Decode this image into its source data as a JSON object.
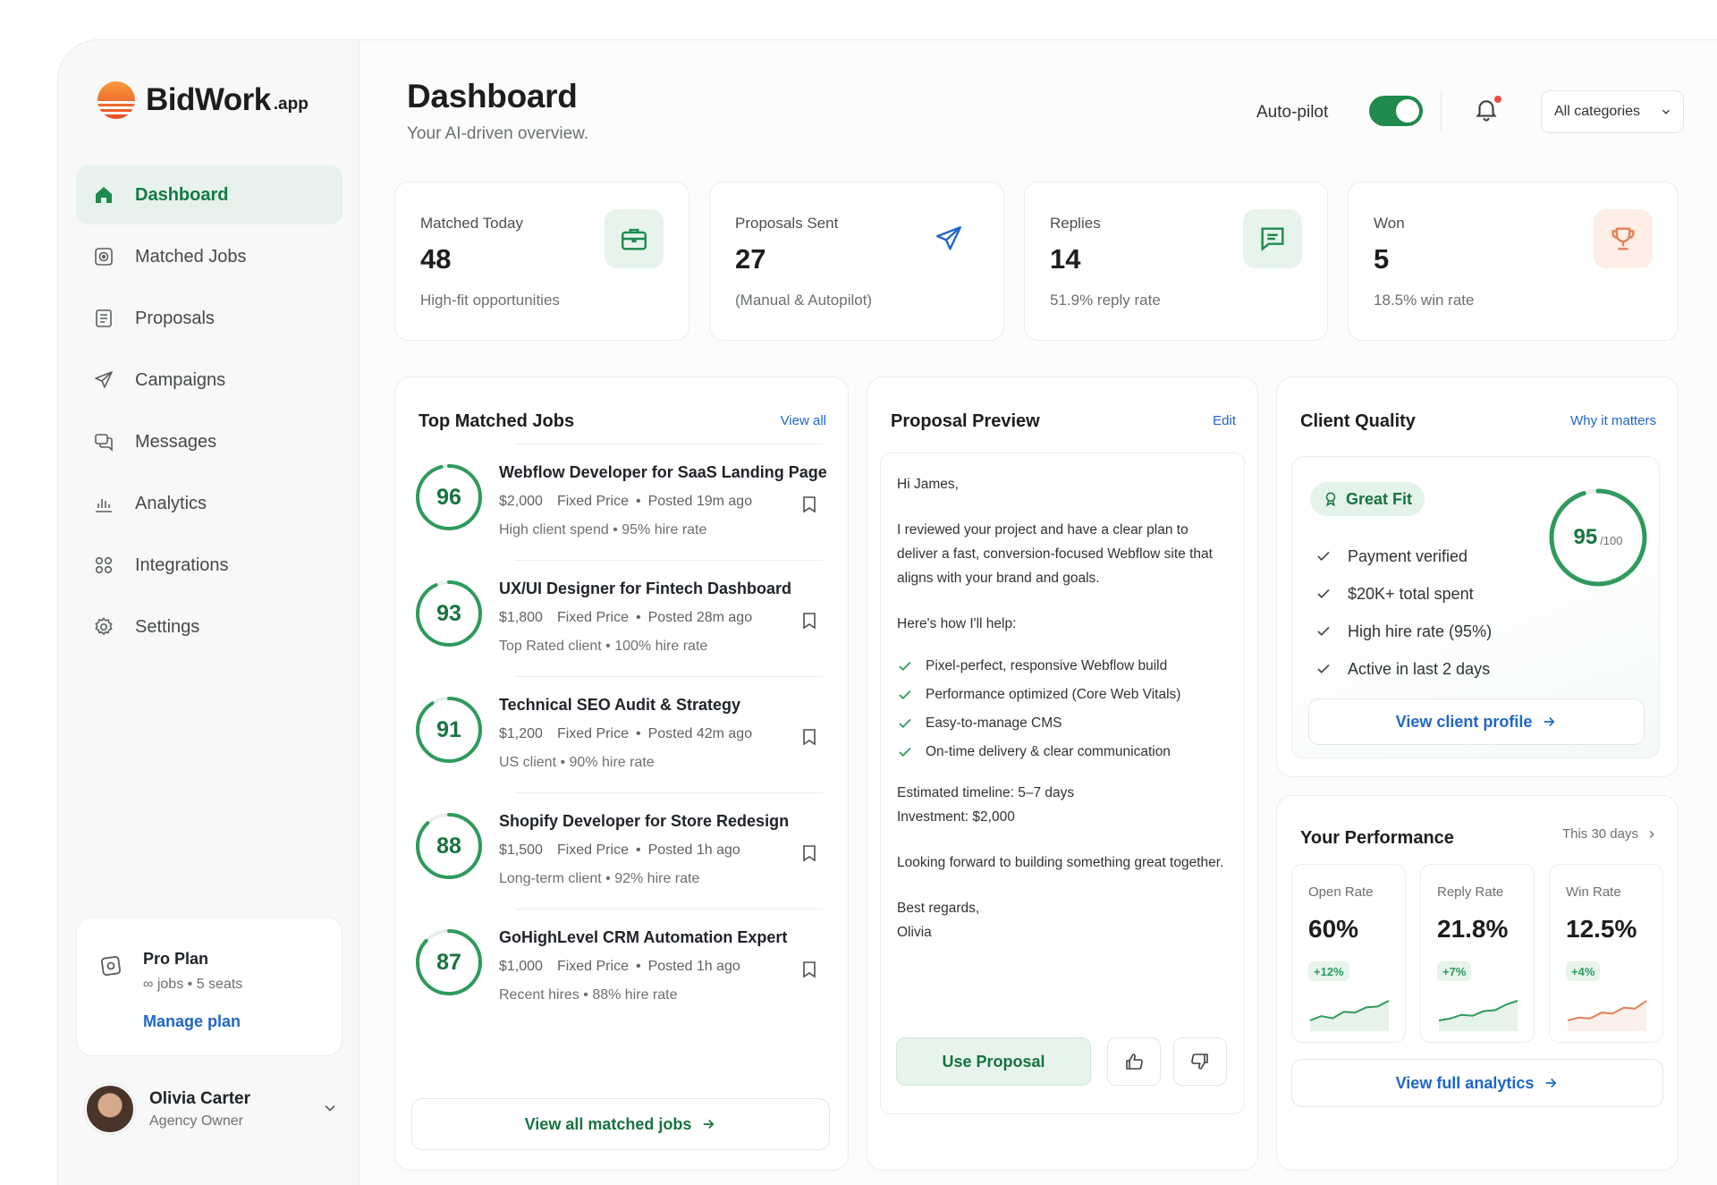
{
  "brand": {
    "name": "BidWork",
    "suffix": ".app"
  },
  "sidebar": {
    "items": [
      {
        "label": "Dashboard",
        "icon": "home-icon"
      },
      {
        "label": "Matched Jobs",
        "icon": "target-icon"
      },
      {
        "label": "Proposals",
        "icon": "document-icon"
      },
      {
        "label": "Campaigns",
        "icon": "send-icon"
      },
      {
        "label": "Messages",
        "icon": "chat-icon"
      },
      {
        "label": "Analytics",
        "icon": "bar-chart-icon"
      },
      {
        "label": "Integrations",
        "icon": "grid-icon"
      },
      {
        "label": "Settings",
        "icon": "gear-icon"
      }
    ],
    "plan": {
      "title": "Pro Plan",
      "detail": "∞ jobs • 5 seats",
      "link": "Manage plan"
    },
    "user": {
      "name": "Olivia Carter",
      "role": "Agency Owner"
    }
  },
  "header": {
    "title": "Dashboard",
    "subtitle": "Your AI-driven overview.",
    "autopilot_label": "Auto-pilot",
    "autopilot_on": true,
    "category": "All categories"
  },
  "stats": [
    {
      "label": "Matched Today",
      "value": "48",
      "sub": "High-fit opportunities",
      "icon": "briefcase-icon"
    },
    {
      "label": "Proposals Sent",
      "value": "27",
      "sub": "(Manual & Autopilot)",
      "icon": "paper-plane-icon"
    },
    {
      "label": "Replies",
      "value": "14",
      "sub": "51.9% reply rate",
      "icon": "message-icon"
    },
    {
      "label": "Won",
      "value": "5",
      "sub": "18.5% win rate",
      "icon": "trophy-icon"
    }
  ],
  "jobs": {
    "title": "Top Matched Jobs",
    "view_all": "View all",
    "items": [
      {
        "score": "96",
        "score_value": 96,
        "title": "Webflow Developer for SaaS Landing Page",
        "price": "$2,000",
        "type": "Fixed Price",
        "posted": "Posted 19m ago",
        "note": "High client spend • 95% hire rate"
      },
      {
        "score": "93",
        "score_value": 93,
        "title": "UX/UI Designer for Fintech Dashboard",
        "price": "$1,800",
        "type": "Fixed Price",
        "posted": "Posted 28m ago",
        "note": "Top Rated client • 100% hire rate"
      },
      {
        "score": "91",
        "score_value": 91,
        "title": "Technical SEO Audit & Strategy",
        "price": "$1,200",
        "type": "Fixed Price",
        "posted": "Posted 42m ago",
        "note": "US client • 90% hire rate"
      },
      {
        "score": "88",
        "score_value": 88,
        "title": "Shopify Developer for Store Redesign",
        "price": "$1,500",
        "type": "Fixed Price",
        "posted": "Posted 1h ago",
        "note": "Long-term client • 92% hire rate"
      },
      {
        "score": "87",
        "score_value": 87,
        "title": "GoHighLevel CRM Automation Expert",
        "price": "$1,000",
        "type": "Fixed Price",
        "posted": "Posted 1h ago",
        "note": "Recent hires • 88% hire rate"
      }
    ],
    "view_all_button": "View all matched jobs"
  },
  "proposal": {
    "title": "Proposal Preview",
    "edit": "Edit",
    "greeting": "Hi James,",
    "intro": "I reviewed your project and have a clear plan to deliver a fast, conversion-focused Webflow site that aligns with your brand and goals.",
    "help_heading": "Here's how I'll help:",
    "points": [
      "Pixel-perfect, responsive Webflow build",
      "Performance optimized (Core Web Vitals)",
      "Easy-to-manage CMS",
      "On-time delivery & clear communication"
    ],
    "timeline": "Estimated timeline: 5–7 days",
    "investment": "Investment: $2,000",
    "closing": "Looking forward to building something great together.",
    "signoff": "Best regards,",
    "signature": "Olivia",
    "use_button": "Use Proposal"
  },
  "client_quality": {
    "title": "Client Quality",
    "link": "Why it matters",
    "badge": "Great Fit",
    "checks": [
      "Payment verified",
      "$20K+ total spent",
      "High hire rate (95%)",
      "Active in last 2 days"
    ],
    "score": "95",
    "score_value": 95,
    "score_max": "/100",
    "profile_button": "View client profile"
  },
  "performance": {
    "title": "Your Performance",
    "range": "This 30 days",
    "metrics": [
      {
        "label": "Open Rate",
        "value": "60%",
        "delta": "+12%",
        "color": "#2e9a5c",
        "trend": [
          3,
          4,
          3.5,
          5,
          4.8,
          6,
          6.2,
          7.5
        ]
      },
      {
        "label": "Reply Rate",
        "value": "21.8%",
        "delta": "+7%",
        "color": "#2e9a5c",
        "trend": [
          3,
          3.4,
          4.2,
          4,
          5,
          5.2,
          6.4,
          7.2
        ]
      },
      {
        "label": "Win Rate",
        "value": "12.5%",
        "delta": "+4%",
        "color": "#e2825a",
        "trend": [
          3,
          3.6,
          3.4,
          4.6,
          4.4,
          5.6,
          5.4,
          7
        ]
      }
    ],
    "analytics_button": "View full analytics"
  },
  "colors": {
    "accent": "#1e8a4c",
    "link": "#1f66c9",
    "warm": "#e2825a"
  }
}
